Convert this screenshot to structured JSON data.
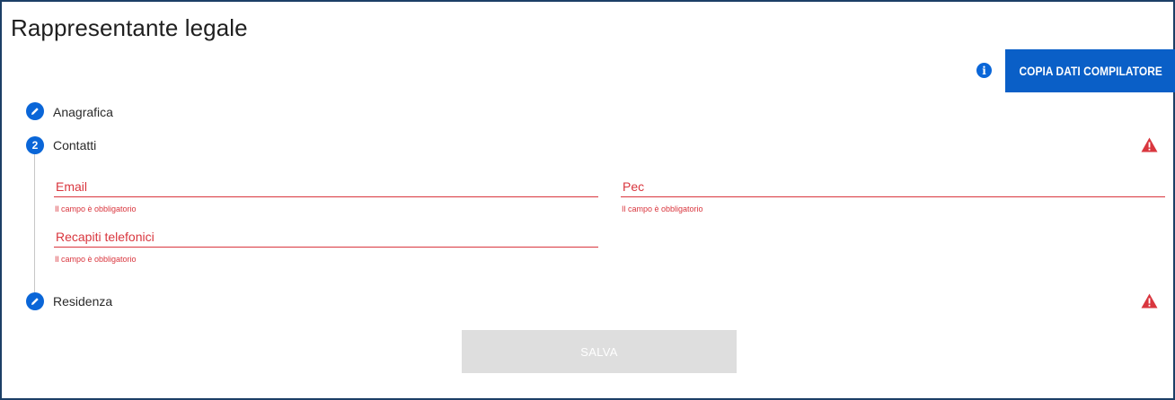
{
  "section_title": "Rappresentante legale",
  "copy_button_label": "COPIA DATI COMPILATORE",
  "steps": [
    {
      "label": "Anagrafica",
      "icon": "pencil-icon"
    },
    {
      "label": "Contatti",
      "number": "2"
    },
    {
      "label": "Residenza",
      "icon": "pencil-icon"
    }
  ],
  "fields": {
    "email": {
      "label": "Email",
      "error": "Il campo è obbligatorio"
    },
    "pec": {
      "label": "Pec",
      "error": "Il campo è obbligatorio"
    },
    "phone": {
      "label": "Recapiti telefonici",
      "error": "Il campo è obbligatorio"
    }
  },
  "save_button_label": "SALVA",
  "colors": {
    "accent": "#0a66d8",
    "error": "#d9363e",
    "border": "#1c3f66",
    "disabled": "#dedede"
  }
}
